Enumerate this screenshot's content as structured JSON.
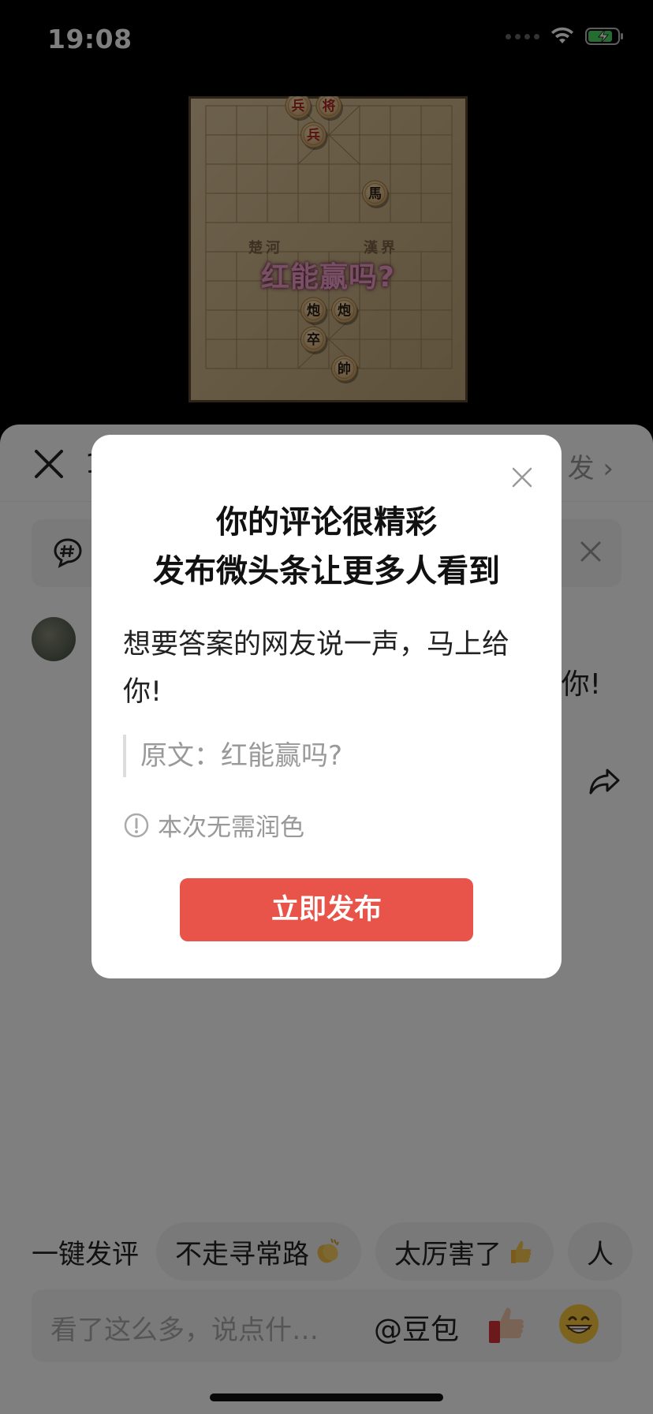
{
  "status_bar": {
    "time": "19:08"
  },
  "video": {
    "caption": "红能赢吗?",
    "river_left": "楚河",
    "river_right": "漢界",
    "pieces": [
      {
        "label": "兵",
        "side": "red"
      },
      {
        "label": "将",
        "side": "red"
      },
      {
        "label": "兵",
        "side": "red"
      },
      {
        "label": "馬",
        "side": "black"
      },
      {
        "label": "炮",
        "side": "black"
      },
      {
        "label": "炮",
        "side": "black"
      },
      {
        "label": "卒",
        "side": "black"
      },
      {
        "label": "帥",
        "side": "black"
      }
    ]
  },
  "sheet": {
    "header_title_partial": "1",
    "publish_label": "发",
    "comment_tail": "你!"
  },
  "quick_comments": {
    "label": "一键发评",
    "chips": [
      "不走寻常路",
      "太厉害了",
      "人"
    ]
  },
  "input_bar": {
    "placeholder": "看了这么多，说点什…",
    "mention": "@豆包"
  },
  "dialog": {
    "title_line1": "你的评论很精彩",
    "title_line2": "发布微头条让更多人看到",
    "body": "想要答案的网友说一声，马上给你!",
    "quote": "原文：红能赢吗?",
    "note": "本次无需润色",
    "button": "立即发布"
  },
  "colors": {
    "accent": "#e9544a",
    "dim": "rgba(0,0,0,0.5)"
  }
}
